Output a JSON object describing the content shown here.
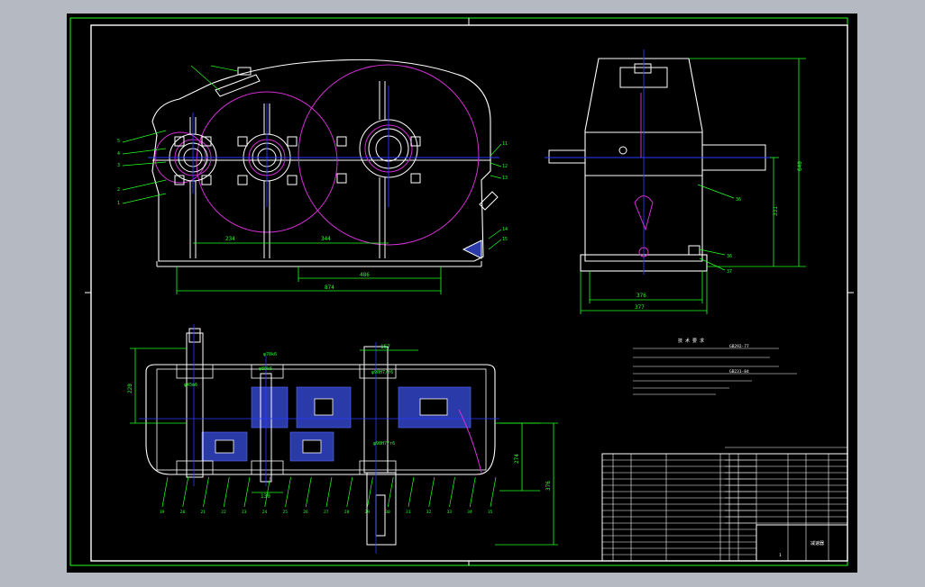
{
  "drawing": {
    "view_front": {
      "dim_center_1": "234",
      "dim_center_2": "344",
      "dim_base_1": "486",
      "dim_base_total": "874",
      "part_numbers_left": [
        "5",
        "4",
        "3",
        "2",
        "1"
      ],
      "part_numbers_right": [
        "11",
        "12",
        "13",
        "14",
        "15"
      ]
    },
    "view_side": {
      "dim_height": "640",
      "dim_center_height": "331",
      "dim_width_inner": "376",
      "dim_width_total": "377",
      "part_numbers": [
        "36",
        "36",
        "37"
      ]
    },
    "view_plan": {
      "dim_left": "220",
      "dim_shaft_1": "φ70k6",
      "dim_shaft_2": "φ45m6",
      "dim_bore_1": "φ80k6",
      "dim_fit_1": "φ90H7/f6",
      "dim_fit_2": "φ90H7/r6",
      "dim_top": "157",
      "dim_bottom": "130",
      "dim_right_1": "274",
      "dim_right_2": "376",
      "part_numbers_bottom": [
        "19",
        "20",
        "21",
        "22",
        "23",
        "24",
        "25",
        "26",
        "27",
        "28",
        "29",
        "30",
        "31",
        "32",
        "33",
        "34",
        "35"
      ]
    },
    "notes": {
      "title": "技 术 要 求",
      "bearing_code_1": "GB292-77",
      "bearing_code_2": "GB231-84"
    },
    "title_block": {
      "drawing_name": "减速器",
      "sheet": "1"
    }
  }
}
